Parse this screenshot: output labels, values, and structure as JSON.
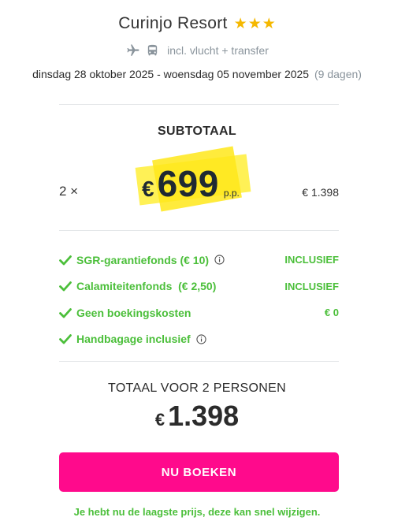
{
  "hotel": {
    "name": "Curinjo Resort",
    "stars": 3
  },
  "transport": {
    "icons": [
      "plane-icon",
      "bus-icon"
    ],
    "text": "incl. vlucht + transfer"
  },
  "dates": {
    "range": "dinsdag 28 oktober 2025 - woensdag 05 november 2025",
    "duration": "(9 dagen)"
  },
  "subtotal": {
    "title": "SUBTOTAAL",
    "quantity": "2 ×",
    "currency": "€",
    "price_per_person": "699",
    "per_person_label": "p.p.",
    "line_total": "€ 1.398",
    "highlight_color": "#ffe81a"
  },
  "inclusions": [
    {
      "label": "SGR-garantiefonds (€ 10)",
      "info": true,
      "value": "INCLUSIEF"
    },
    {
      "label": "Calamiteitenfonds  (€ 2,50)",
      "info": false,
      "value": "INCLUSIEF"
    },
    {
      "label": "Geen boekingskosten",
      "info": false,
      "value": "€ 0"
    },
    {
      "label": "Handbagage inclusief",
      "info": true,
      "value": ""
    }
  ],
  "total": {
    "title": "TOTAAL VOOR 2 PERSONEN",
    "currency": "€",
    "value": "1.398"
  },
  "cta": {
    "label": "NU BOEKEN",
    "color": "#ff0a8c"
  },
  "notice": "Je hebt nu de laagste prijs, deze kan snel wijzigen.",
  "colors": {
    "accent_green": "#4bbf3a",
    "star": "#f5b800",
    "muted": "#8a949c"
  }
}
